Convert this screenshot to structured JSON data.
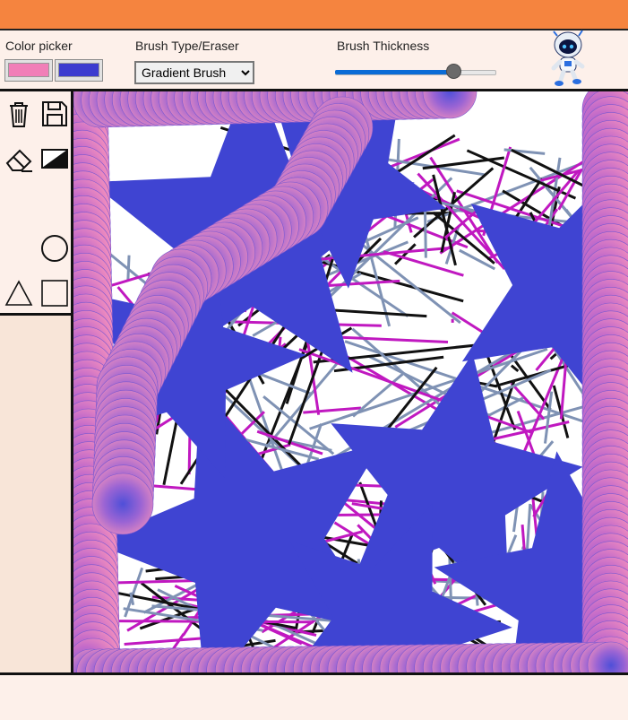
{
  "toolbar": {
    "color_picker_label": "Color picker",
    "brush_type_label": "Brush Type/Eraser",
    "brush_thickness_label": "Brush Thickness",
    "primary_color": "#f17fb8",
    "secondary_color": "#3c3ccf",
    "brush_type_selected": "Gradient Brush",
    "brush_thickness_fraction": 0.74
  },
  "tools": [
    {
      "name": "trash-icon"
    },
    {
      "name": "save-icon"
    },
    {
      "name": "eraser-icon"
    },
    {
      "name": "fill-toggle-icon"
    },
    {
      "name": "circle-shape-icon"
    },
    {
      "name": "triangle-shape-icon"
    },
    {
      "name": "square-shape-icon"
    }
  ],
  "colors": {
    "titlebar": "#f5843f",
    "star_blue": "#3f44d2",
    "line_magenta": "#c018c0",
    "line_slate": "#7f92b4",
    "line_black": "#111111"
  }
}
